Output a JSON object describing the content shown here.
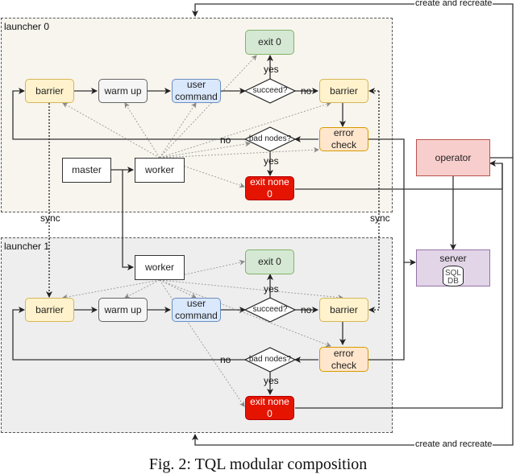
{
  "caption": "Fig. 2: TQL modular composition",
  "colors": {
    "barrier_fill": "#fff2cc",
    "barrier_stroke": "#d6b656",
    "warmup_fill": "#f5f5f5",
    "warmup_stroke": "#666666",
    "user_fill": "#dae8fc",
    "user_stroke": "#6c8ebf",
    "exit0_fill": "#d5e8d4",
    "exit0_stroke": "#82b366",
    "exitnone_fill": "#e51400",
    "exitnone_stroke": "#b20000",
    "errorcheck_fill": "#ffe6cc",
    "errorcheck_stroke": "#d79b00",
    "operator_fill": "#f8cecc",
    "operator_stroke": "#b85450",
    "server_fill": "#e1d5e7",
    "server_stroke": "#9673a6",
    "launcher0_bg": "#f8f5ee",
    "launcher1_bg": "#eeeeee"
  },
  "launchers": [
    {
      "label": "launcher 0",
      "nodes": {
        "barrier_start": "barrier",
        "warm_up": "warm up",
        "user_command": [
          "user",
          "command"
        ],
        "succeed": "succeed?",
        "exit0": "exit 0",
        "barrier_end": "barrier",
        "error_check": [
          "error",
          "check"
        ],
        "bad_nodes": "bad nodes?",
        "exit_none": [
          "exit none",
          "0"
        ],
        "master": "master",
        "worker": "worker"
      },
      "edge_labels": {
        "yes_succeed": "yes",
        "no_succeed": "no",
        "no_bad": "no",
        "yes_bad": "yes"
      }
    },
    {
      "label": "launcher 1",
      "nodes": {
        "barrier_start": "barrier",
        "warm_up": "warm up",
        "user_command": [
          "user",
          "command"
        ],
        "succeed": "succeed?",
        "exit0": "exit 0",
        "barrier_end": "barrier",
        "error_check": [
          "error",
          "check"
        ],
        "bad_nodes": "bad nodes?",
        "exit_none": [
          "exit none",
          "0"
        ],
        "worker": "worker"
      },
      "edge_labels": {
        "yes_succeed": "yes",
        "no_succeed": "no",
        "no_bad": "no",
        "yes_bad": "yes"
      }
    }
  ],
  "sync_labels": [
    "sync",
    "sync"
  ],
  "operator": "operator",
  "server": {
    "label": "server",
    "db": [
      "SQL",
      "DB"
    ]
  },
  "create_labels": [
    "create and recreate",
    "create and recreate"
  ]
}
